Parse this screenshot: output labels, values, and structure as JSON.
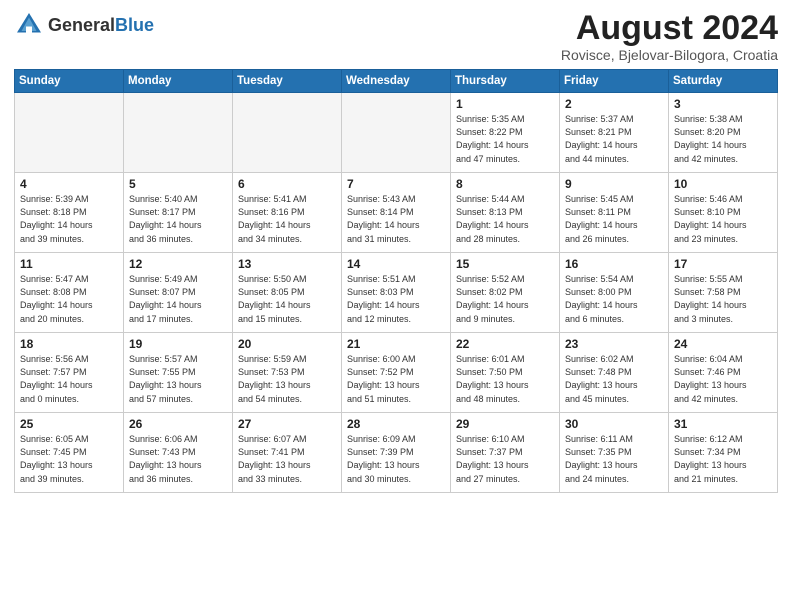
{
  "header": {
    "logo_general": "General",
    "logo_blue": "Blue",
    "month_year": "August 2024",
    "location": "Rovisce, Bjelovar-Bilogora, Croatia"
  },
  "days_of_week": [
    "Sunday",
    "Monday",
    "Tuesday",
    "Wednesday",
    "Thursday",
    "Friday",
    "Saturday"
  ],
  "weeks": [
    [
      {
        "day": "",
        "info": ""
      },
      {
        "day": "",
        "info": ""
      },
      {
        "day": "",
        "info": ""
      },
      {
        "day": "",
        "info": ""
      },
      {
        "day": "1",
        "info": "Sunrise: 5:35 AM\nSunset: 8:22 PM\nDaylight: 14 hours\nand 47 minutes."
      },
      {
        "day": "2",
        "info": "Sunrise: 5:37 AM\nSunset: 8:21 PM\nDaylight: 14 hours\nand 44 minutes."
      },
      {
        "day": "3",
        "info": "Sunrise: 5:38 AM\nSunset: 8:20 PM\nDaylight: 14 hours\nand 42 minutes."
      }
    ],
    [
      {
        "day": "4",
        "info": "Sunrise: 5:39 AM\nSunset: 8:18 PM\nDaylight: 14 hours\nand 39 minutes."
      },
      {
        "day": "5",
        "info": "Sunrise: 5:40 AM\nSunset: 8:17 PM\nDaylight: 14 hours\nand 36 minutes."
      },
      {
        "day": "6",
        "info": "Sunrise: 5:41 AM\nSunset: 8:16 PM\nDaylight: 14 hours\nand 34 minutes."
      },
      {
        "day": "7",
        "info": "Sunrise: 5:43 AM\nSunset: 8:14 PM\nDaylight: 14 hours\nand 31 minutes."
      },
      {
        "day": "8",
        "info": "Sunrise: 5:44 AM\nSunset: 8:13 PM\nDaylight: 14 hours\nand 28 minutes."
      },
      {
        "day": "9",
        "info": "Sunrise: 5:45 AM\nSunset: 8:11 PM\nDaylight: 14 hours\nand 26 minutes."
      },
      {
        "day": "10",
        "info": "Sunrise: 5:46 AM\nSunset: 8:10 PM\nDaylight: 14 hours\nand 23 minutes."
      }
    ],
    [
      {
        "day": "11",
        "info": "Sunrise: 5:47 AM\nSunset: 8:08 PM\nDaylight: 14 hours\nand 20 minutes."
      },
      {
        "day": "12",
        "info": "Sunrise: 5:49 AM\nSunset: 8:07 PM\nDaylight: 14 hours\nand 17 minutes."
      },
      {
        "day": "13",
        "info": "Sunrise: 5:50 AM\nSunset: 8:05 PM\nDaylight: 14 hours\nand 15 minutes."
      },
      {
        "day": "14",
        "info": "Sunrise: 5:51 AM\nSunset: 8:03 PM\nDaylight: 14 hours\nand 12 minutes."
      },
      {
        "day": "15",
        "info": "Sunrise: 5:52 AM\nSunset: 8:02 PM\nDaylight: 14 hours\nand 9 minutes."
      },
      {
        "day": "16",
        "info": "Sunrise: 5:54 AM\nSunset: 8:00 PM\nDaylight: 14 hours\nand 6 minutes."
      },
      {
        "day": "17",
        "info": "Sunrise: 5:55 AM\nSunset: 7:58 PM\nDaylight: 14 hours\nand 3 minutes."
      }
    ],
    [
      {
        "day": "18",
        "info": "Sunrise: 5:56 AM\nSunset: 7:57 PM\nDaylight: 14 hours\nand 0 minutes."
      },
      {
        "day": "19",
        "info": "Sunrise: 5:57 AM\nSunset: 7:55 PM\nDaylight: 13 hours\nand 57 minutes."
      },
      {
        "day": "20",
        "info": "Sunrise: 5:59 AM\nSunset: 7:53 PM\nDaylight: 13 hours\nand 54 minutes."
      },
      {
        "day": "21",
        "info": "Sunrise: 6:00 AM\nSunset: 7:52 PM\nDaylight: 13 hours\nand 51 minutes."
      },
      {
        "day": "22",
        "info": "Sunrise: 6:01 AM\nSunset: 7:50 PM\nDaylight: 13 hours\nand 48 minutes."
      },
      {
        "day": "23",
        "info": "Sunrise: 6:02 AM\nSunset: 7:48 PM\nDaylight: 13 hours\nand 45 minutes."
      },
      {
        "day": "24",
        "info": "Sunrise: 6:04 AM\nSunset: 7:46 PM\nDaylight: 13 hours\nand 42 minutes."
      }
    ],
    [
      {
        "day": "25",
        "info": "Sunrise: 6:05 AM\nSunset: 7:45 PM\nDaylight: 13 hours\nand 39 minutes."
      },
      {
        "day": "26",
        "info": "Sunrise: 6:06 AM\nSunset: 7:43 PM\nDaylight: 13 hours\nand 36 minutes."
      },
      {
        "day": "27",
        "info": "Sunrise: 6:07 AM\nSunset: 7:41 PM\nDaylight: 13 hours\nand 33 minutes."
      },
      {
        "day": "28",
        "info": "Sunrise: 6:09 AM\nSunset: 7:39 PM\nDaylight: 13 hours\nand 30 minutes."
      },
      {
        "day": "29",
        "info": "Sunrise: 6:10 AM\nSunset: 7:37 PM\nDaylight: 13 hours\nand 27 minutes."
      },
      {
        "day": "30",
        "info": "Sunrise: 6:11 AM\nSunset: 7:35 PM\nDaylight: 13 hours\nand 24 minutes."
      },
      {
        "day": "31",
        "info": "Sunrise: 6:12 AM\nSunset: 7:34 PM\nDaylight: 13 hours\nand 21 minutes."
      }
    ]
  ]
}
